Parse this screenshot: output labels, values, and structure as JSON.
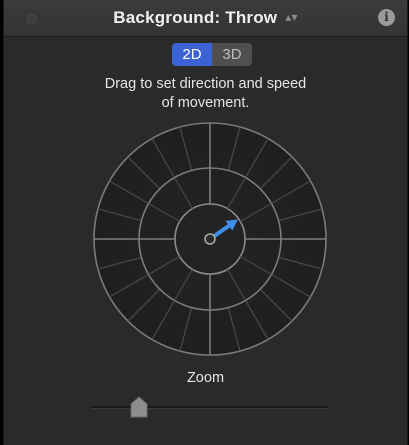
{
  "window": {
    "title": "Background: Throw",
    "title_menu_icon": "updown-chevron-icon",
    "info_icon": "info-icon",
    "info_glyph": "i"
  },
  "mode": {
    "options": [
      "2D",
      "3D"
    ],
    "selected": "2D"
  },
  "instructions": {
    "line1": "Drag to set direction and speed",
    "line2": "of movement."
  },
  "zoom": {
    "label": "Zoom",
    "value": 0.2
  },
  "direction_control": {
    "arrow_angle_deg": 35,
    "arrow_length_fraction": 0.48
  },
  "colors": {
    "accent": "#3c63d6",
    "arrow": "#3f8fe8",
    "panel": "#2a2a2a"
  }
}
